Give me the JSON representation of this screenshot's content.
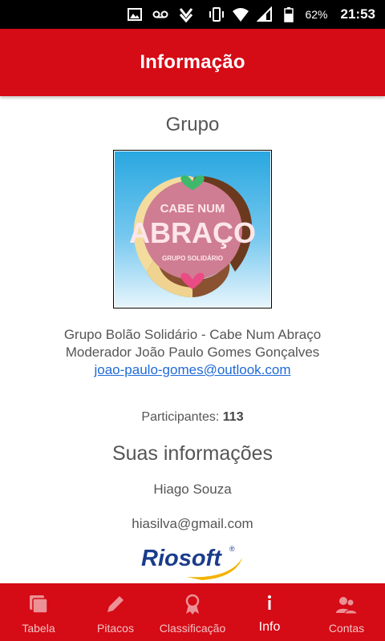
{
  "status_bar": {
    "battery_percent": "62%",
    "time": "21:53",
    "icons": [
      "image-icon",
      "voicemail-icon",
      "download-icon",
      "vibrate-icon",
      "wifi-icon",
      "cell-signal-icon",
      "battery-icon"
    ]
  },
  "app_bar": {
    "title": "Informação"
  },
  "group": {
    "heading": "Grupo",
    "logo": {
      "line1": "CABE NUM",
      "line2": "ABRAÇO",
      "line3": "GRUPO SOLIDÁRIO"
    },
    "name": "Grupo Bolão Solidário - Cabe Num Abraço",
    "moderator": "Moderador João Paulo Gomes Gonçalves",
    "email": "joao-paulo-gomes@outlook.com",
    "participants_label": "Participantes: ",
    "participants_count": "113"
  },
  "your_info": {
    "heading": "Suas informações",
    "name": "Hiago Souza",
    "email": "hiasilva@gmail.com"
  },
  "brand": {
    "name": "Riosoft",
    "mark": "®"
  },
  "colors": {
    "primary": "#d50b16",
    "link": "#1e6ad8"
  },
  "bottom_nav": {
    "items": [
      {
        "label": "Tabela",
        "icon": "table-icon",
        "active": false
      },
      {
        "label": "Pitacos",
        "icon": "pencil-icon",
        "active": false
      },
      {
        "label": "Classificação",
        "icon": "award-icon",
        "active": false
      },
      {
        "label": "Info",
        "icon": "info-icon",
        "active": true
      },
      {
        "label": "Contas",
        "icon": "people-icon",
        "active": false
      }
    ]
  }
}
